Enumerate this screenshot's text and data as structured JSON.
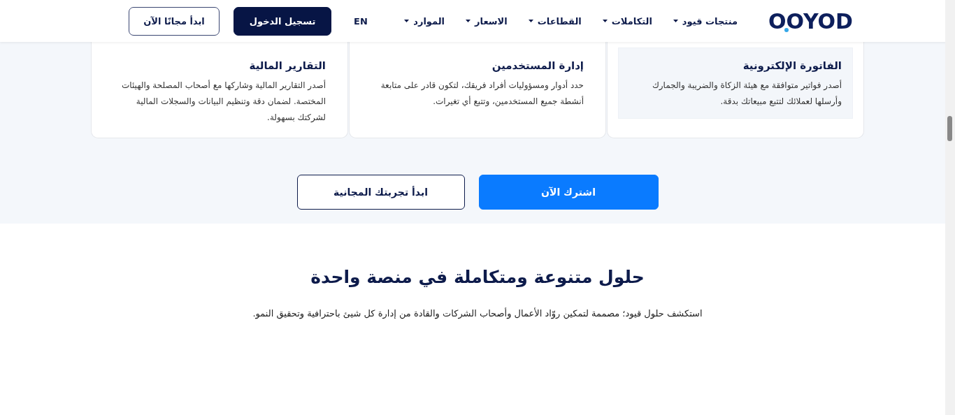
{
  "header": {
    "logo": "OOYOD",
    "nav": [
      {
        "label": "منتجات قيود",
        "has_menu": true
      },
      {
        "label": "التكاملات",
        "has_menu": true
      },
      {
        "label": "القطاعات",
        "has_menu": true
      },
      {
        "label": "الاسعار",
        "has_menu": true
      },
      {
        "label": "الموارد",
        "has_menu": true
      }
    ],
    "language": "EN",
    "buttons": [
      {
        "label": "تسجيل الدخول",
        "kind": "primary"
      },
      {
        "label": "ابدأ مجانًا الآن",
        "kind": "outline"
      }
    ]
  },
  "features": [
    {
      "title": "الفاتورة الإلكترونية",
      "text": "أصدر فواتير متوافقة مع هيئة الزكاة والضريبة والجمارك وأرسلها لعملائك لتتبع مبيعاتك بدقة.",
      "highlighted": true
    },
    {
      "title": "إدارة المستخدمين",
      "text": "حدد أدوار ومسؤوليات أفراد فريقك، لتكون قادر على متابعة أنشطة جميع المستخدمين، وتتبع أي تغيرات.",
      "highlighted": false
    },
    {
      "title": "التقارير المالية",
      "text": "أصدر التقارير المالية وشاركها مع أصحاب المصلحة والهيئات المختصة. لضمان دقة وتنظيم البيانات والسجلات المالية لشركتك بسهولة.",
      "highlighted": false
    }
  ],
  "cta_buttons": [
    {
      "label": "اشترك الآن",
      "kind": "primary"
    },
    {
      "label": "ابدأ تجربتك المجانية",
      "kind": "outline"
    }
  ],
  "solutions": {
    "heading": "حلول متنوعة ومتكاملة في منصة واحدة",
    "subtitle": "استكشف حلول قيود؛ مصممة لتمكين روّاد الأعمال وأصحاب الشركات والقادة من إدارة كل شيئ باحترافية وتحقيق النمو."
  }
}
